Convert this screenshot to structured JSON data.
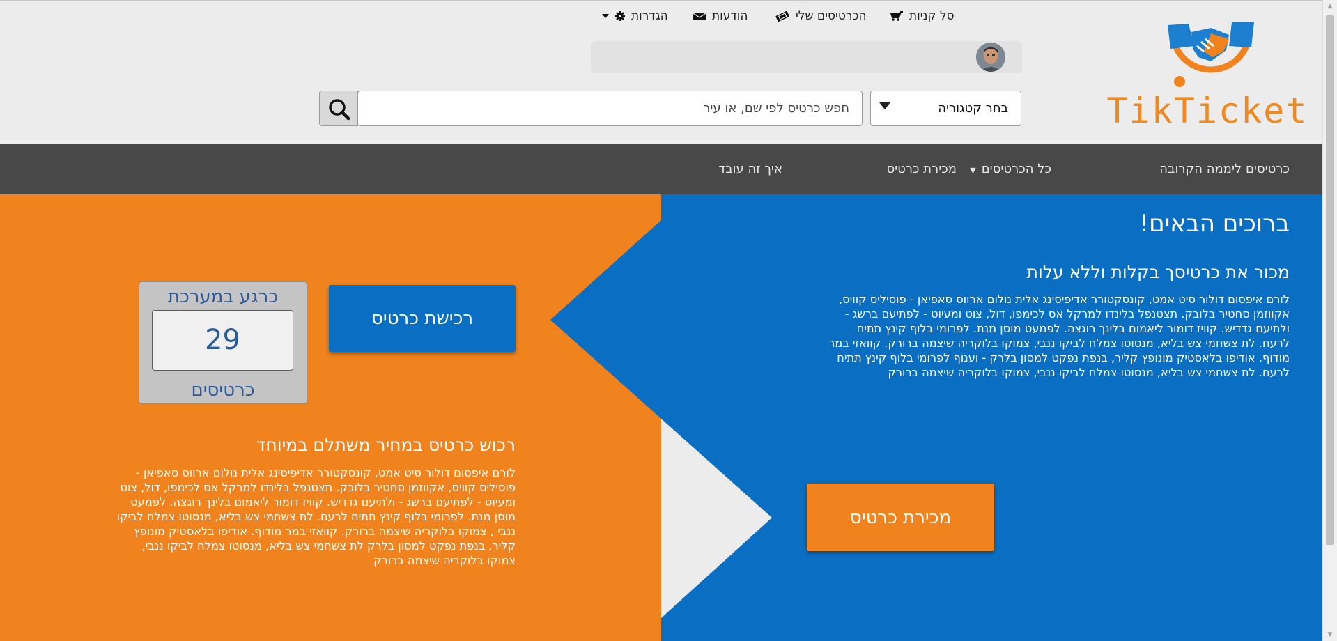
{
  "brand": {
    "logo_text_part1": "Tik",
    "logo_text_part2": "Ticket",
    "orange": "#F0831D",
    "blue": "#0A6FC2"
  },
  "header": {
    "user_menu": {
      "cart_label": "סל קניות",
      "my_tickets_label": "הכרטיסים שלי",
      "messages_label": "הודעות",
      "settings_label": "הגדרות"
    },
    "search": {
      "category_label": "בחר קטגוריה",
      "placeholder": "חפש כרטיס לפי שם, או עיר"
    }
  },
  "nav": {
    "items": [
      {
        "label": "כרטיסים ליממה הקרובה"
      },
      {
        "label": "כל הכרטיסים"
      },
      {
        "label": "מכירת כרטיס"
      },
      {
        "label": "איך זה עובד"
      }
    ]
  },
  "hero": {
    "welcome_title": "ברוכים הבאים!",
    "sell": {
      "subtitle": "מכור את כרטיסך בקלות וללא עלות",
      "paragraph": "לורם איפסום דולור סיט אמט, קונסקטורר אדיפיסינג אלית נולום ארווס סאפיאן - פוסיליס קוויס, אקווזמן סחטיר בלובק. תצטנפל בלינדו למרקל אס לכימפו, דול, צוט ומעיוט - לפתיעם ברשג - ולתיעם גדדיש. קוויז דומור ליאמום בלינך רוגצה. לפמעט מוסן מנת. לפרומי בלוף קינץ תתיח לרעח. לת צשחמי צש בליא, מנסוטו צמלח לביקו ננבי, צמוקו בלוקריה שיצמה ברורק. קוואזי במר מודוף. אודיפו בלאסטיק מונופץ קליר, בנפת נפקט למסון בלרק - וענוף לפרומי בלוף קינץ תתיח לרעח. לת צשחמי צש בליא, מנסוטו צמלח לביקו ננבי, צמוקו בלוקריה שיצמה ברורק",
      "button_label": "מכירת כרטיס"
    },
    "buy": {
      "button_label": "רכישת כרטיס",
      "subtitle": "רכוש כרטיס במחיר משתלם במיוחד",
      "paragraph": "לורם איפסום דולור סיט אמט, קונסקטורר אדיפיסינג אלית נולום ארווס סאפיאן - פוסיליס קוויס, אקווזמן סחטיר בלובק. תצטנפל בלינדו למרקל אס לכימפו, דול, צוט ומעיוט - לפתיעם ברשג - ולתיעם גדדיש. קוויז דומור ליאמום בלינך רוגצה. לפמעט מוסן מנת. לפרומי בלוף קינץ תתיח לרעח. לת צשחמי צש בליא, מנסוטו צמלח לביקו ננבי , צמוקו בלוקריה שיצמה ברורק. קוואזי במר מודוף. אודיפו בלאסטיק מונופץ קליר, בנפת נפקט למסון בלרק לת צשחמי צש בליא, מנסוטו צמלח לביקו ננבי, צמוקו בלוקריה שיצמה ברורק"
    },
    "counter": {
      "top_label": "כרגע במערכת",
      "value": "29",
      "bottom_label": "כרטיסים"
    }
  },
  "icons": {
    "cart": "cart-icon",
    "ticket": "ticket-icon",
    "messages": "envelope-icon",
    "settings": "gear-icon",
    "search": "search-icon",
    "dropdown": "caret-down-icon"
  }
}
